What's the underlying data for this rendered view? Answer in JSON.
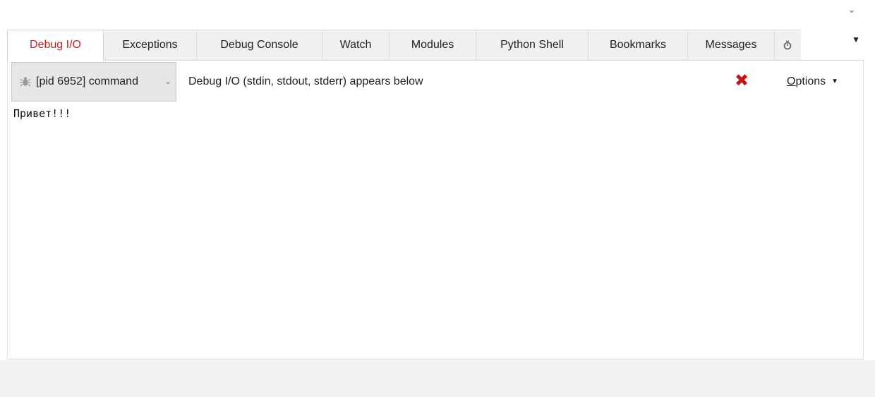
{
  "tabs": [
    {
      "label": "Debug I/O",
      "active": true
    },
    {
      "label": "Exceptions",
      "active": false
    },
    {
      "label": "Debug Console",
      "active": false
    },
    {
      "label": "Watch",
      "active": false
    },
    {
      "label": "Modules",
      "active": false
    },
    {
      "label": "Python Shell",
      "active": false
    },
    {
      "label": "Bookmarks",
      "active": false
    },
    {
      "label": "Messages",
      "active": false
    }
  ],
  "icons": {
    "top_chevron": "chevron-down-icon",
    "tab_overflow": "triangle-down-icon",
    "process": "bug-icon",
    "clear": "close-x-icon"
  },
  "toolbar": {
    "process_label": "[pid 6952] command",
    "status": "Debug I/O (stdin, stdout, stderr) appears below",
    "options_mnemonic": "O",
    "options_rest": "ptions"
  },
  "output": {
    "text": "Привет!!!"
  },
  "colors": {
    "active_tab_text": "#cc2020",
    "clear_icon": "#c01818",
    "select_bg": "#e7e7e7",
    "bottom_strip": "#f2f2f2"
  }
}
